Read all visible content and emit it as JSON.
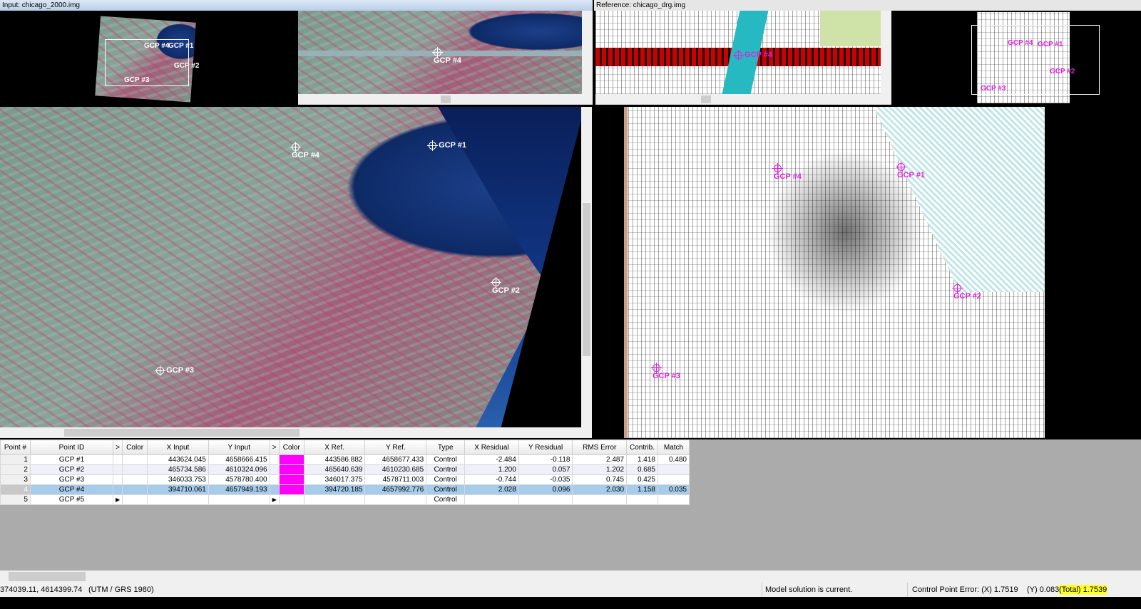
{
  "input_title": "Input: chicago_2000.img",
  "reference_title": "Reference: chicago_drg.img",
  "input_overview_gcps": [
    "GCP #4",
    "GCP #1",
    "GCP #2",
    "GCP #3"
  ],
  "input_magnifier_gcp": "GCP #4",
  "reference_magnifier_gcp": "GCP #4",
  "reference_overview_gcps": [
    "GCP #4",
    "GCP #1",
    "GCP #2",
    "GCP #3"
  ],
  "input_main_gcps": [
    "GCP #1",
    "GCP #2",
    "GCP #3",
    "GCP #4"
  ],
  "reference_main_gcps": [
    "GCP #1",
    "GCP #2",
    "GCP #3",
    "GCP #4"
  ],
  "table": {
    "headers": [
      "Point #",
      "Point ID",
      ">",
      "Color",
      "X Input",
      "Y Input",
      ">",
      "Color",
      "X Ref.",
      "Y Ref.",
      "Type",
      "X Residual",
      "Y Residual",
      "RMS Error",
      "Contrib.",
      "Match"
    ],
    "rows": [
      {
        "num": "1",
        "id": "GCP #1",
        "xin": "443624.045",
        "yin": "4658666.415",
        "xref": "443586.882",
        "yref": "4658677.433",
        "type": "Control",
        "xres": "-2.484",
        "yres": "-0.118",
        "rms": "2.487",
        "contrib": "1.418",
        "match": "0.480"
      },
      {
        "num": "2",
        "id": "GCP #2",
        "xin": "465734.586",
        "yin": "4610324.096",
        "xref": "465640.639",
        "yref": "4610230.685",
        "type": "Control",
        "xres": "1.200",
        "yres": "0.057",
        "rms": "1.202",
        "contrib": "0.685",
        "match": ""
      },
      {
        "num": "3",
        "id": "GCP #3",
        "xin": "346033.753",
        "yin": "4578780.400",
        "xref": "346017.375",
        "yref": "4578711.003",
        "type": "Control",
        "xres": "-0.744",
        "yres": "-0.035",
        "rms": "0.745",
        "contrib": "0.425",
        "match": ""
      },
      {
        "num": "4",
        "id": "GCP #4",
        "xin": "394710.061",
        "yin": "4657949.193",
        "xref": "394720.185",
        "yref": "4657992.776",
        "type": "Control",
        "xres": "2.028",
        "yres": "0.096",
        "rms": "2.030",
        "contrib": "1.158",
        "match": "0.035"
      },
      {
        "num": "5",
        "id": "GCP #5",
        "xin": "",
        "yin": "",
        "xref": "",
        "yref": "",
        "type": "Control",
        "xres": "",
        "yres": "",
        "rms": "",
        "contrib": "",
        "match": ""
      }
    ],
    "gcp_color": "#ff00ff"
  },
  "status": {
    "coords": "374039.11, 4614399.74",
    "projection": "(UTM / GRS 1980)",
    "model": "Model solution is current.",
    "cp_error_label": "Control Point Error: (X) 1.7519",
    "y_error": "(Y) 0.0830",
    "total": "(Total) 1.7539"
  }
}
